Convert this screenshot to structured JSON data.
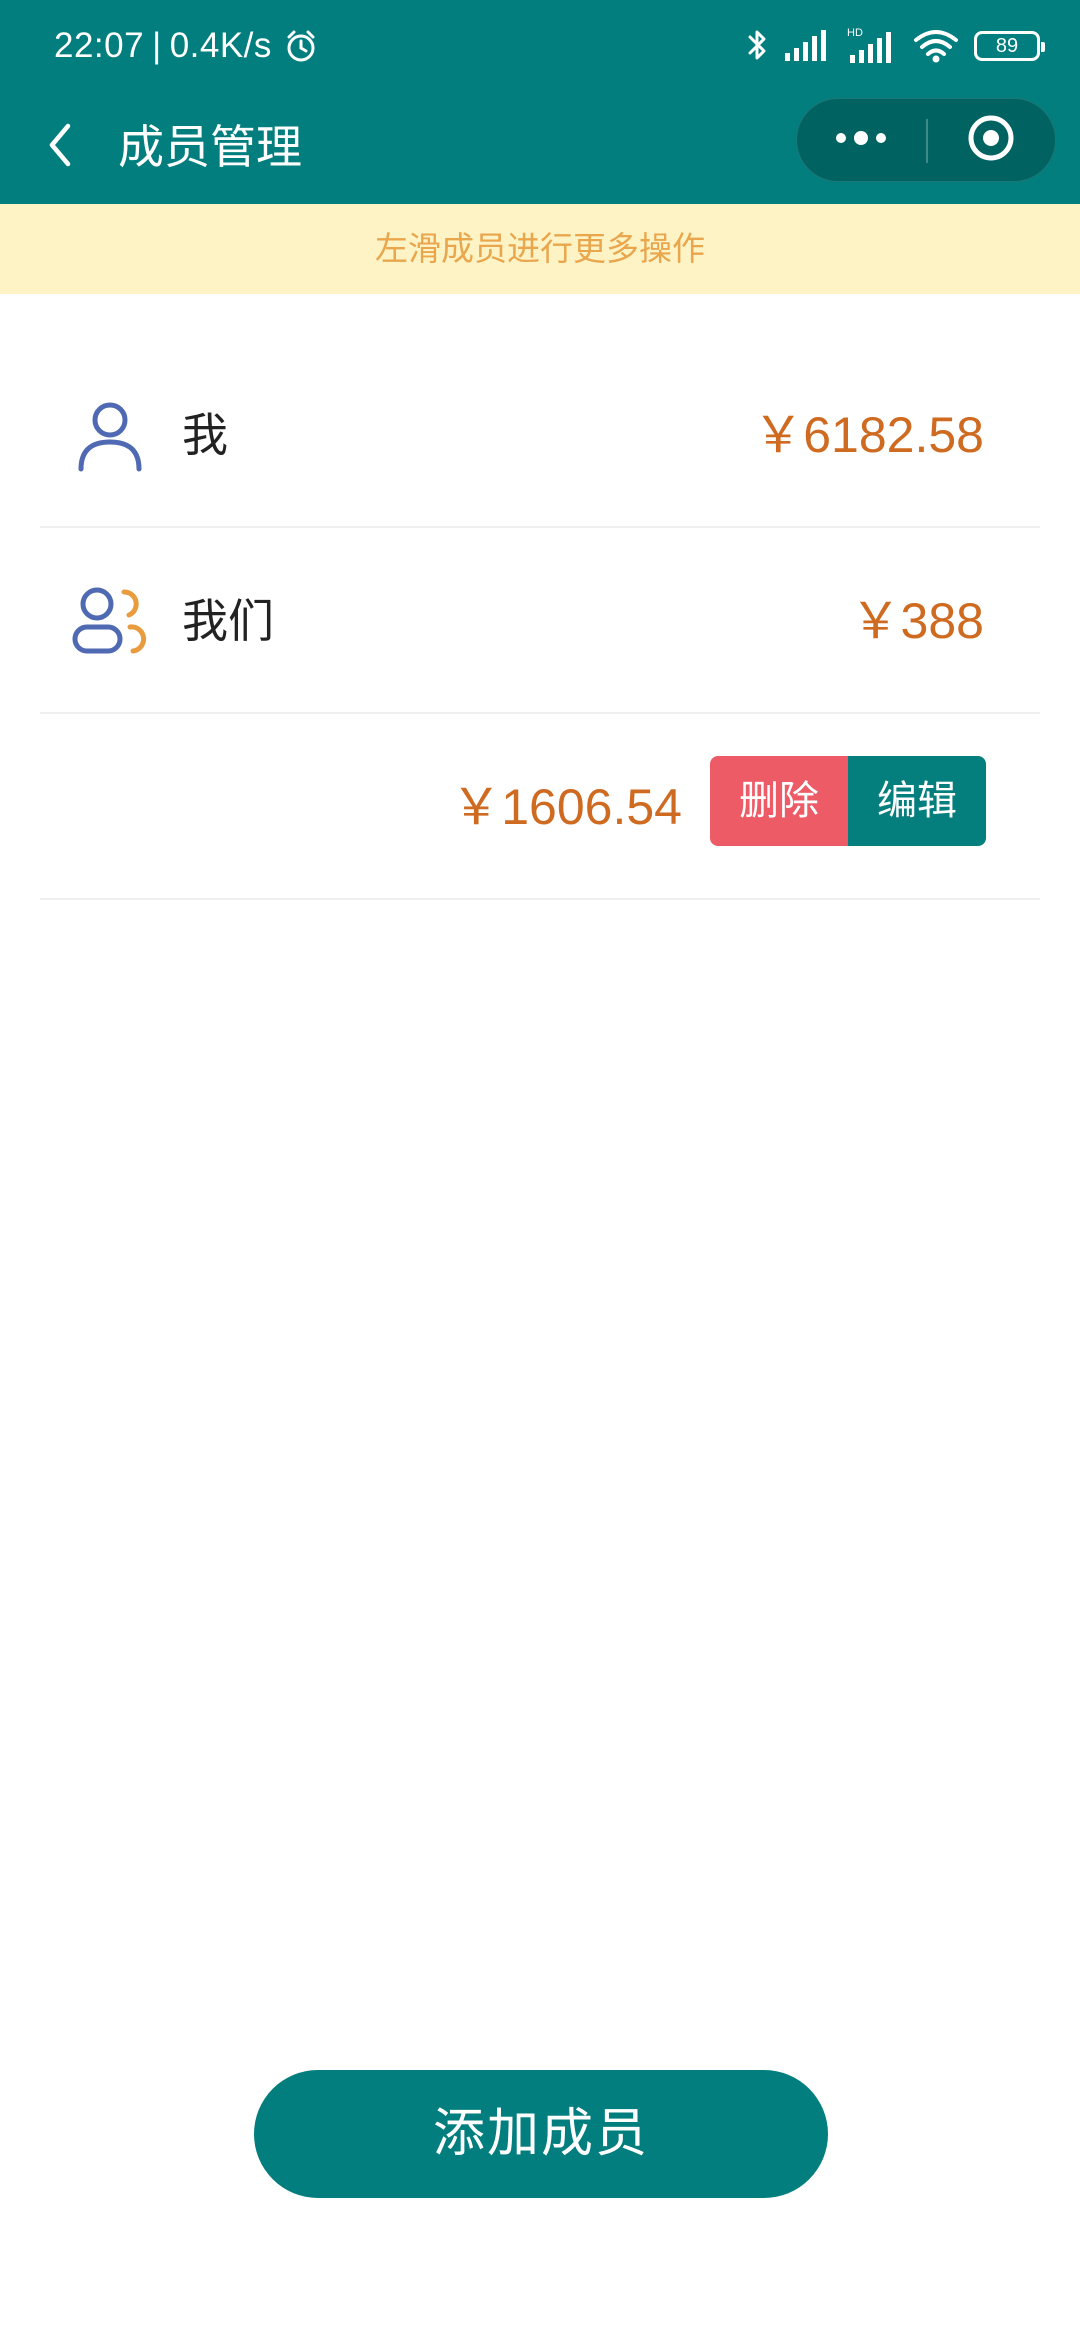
{
  "status_bar": {
    "time": "22:07",
    "separator": "|",
    "network_speed": "0.4K/s",
    "battery": "89",
    "icons": [
      "alarm-icon",
      "bluetooth-icon",
      "signal-icon",
      "hd-signal-icon",
      "wifi-icon",
      "battery-icon"
    ]
  },
  "nav": {
    "title": "成员管理",
    "back_icon": "chevron-left-icon",
    "more_icon": "more-dots-icon",
    "close_icon": "target-close-icon"
  },
  "notice": {
    "text": "左滑成员进行更多操作"
  },
  "members": [
    {
      "name": "我",
      "amount": "￥6182.58",
      "icon": "person-icon"
    },
    {
      "name": "我们",
      "amount": "￥388",
      "icon": "group-icon"
    },
    {
      "name": "",
      "amount": "￥1606.54",
      "actions": {
        "delete_label": "删除",
        "edit_label": "编辑"
      }
    }
  ],
  "footer": {
    "add_button_label": "添加成员"
  },
  "colors": {
    "primary": "#017e7d",
    "notice_bg": "#fdf3c5",
    "notice_text": "#e9a64d",
    "amount": "#cf6a21",
    "delete": "#ed5b67",
    "edit": "#047f7d",
    "icon_blue": "#4f6ab2",
    "icon_orange": "#e99c3d"
  }
}
